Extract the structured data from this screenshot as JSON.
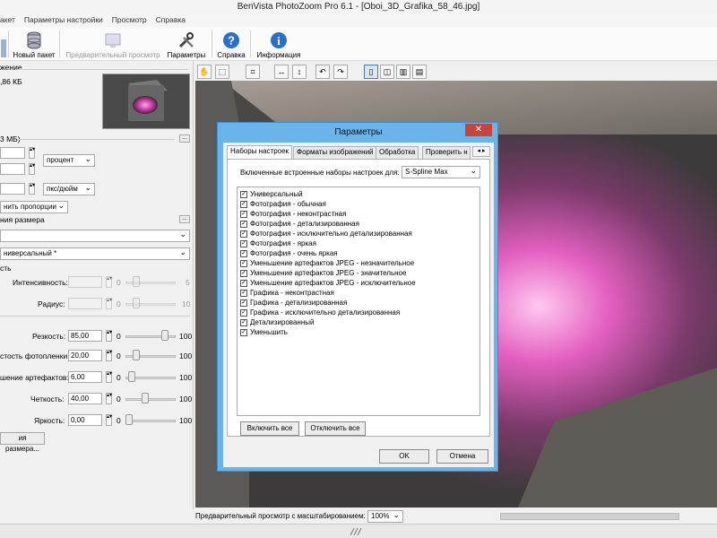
{
  "window": {
    "title": "BenVista PhotoZoom Pro 6.1 - [Oboi_3D_Grafika_58_46.jpg]"
  },
  "menu": [
    "акет",
    "Параметры настройки",
    "Просмотр",
    "Справка"
  ],
  "toolbar": {
    "new_batch": "Новый пакет",
    "preview": "Предварительный просмотр",
    "settings": "Параметры",
    "help": "Справка",
    "info": "Информация"
  },
  "left": {
    "section1": "жение",
    "file_size": ",86 КБ",
    "section2": "3 МБ)",
    "unit_percent": "процент",
    "unit_resolution": "пкс/дюйм",
    "keep_proportions": "нить пропорции",
    "resize_method_label": "ния размера",
    "preset_value": "ниверсальный *",
    "section3": "сть",
    "intensity_label": "Интенсивность:",
    "radius_label": "Радиус:",
    "sharpness_label": "Резкость:",
    "sharpness_value": "85,00",
    "film_grain_label": "стость фотопленки:",
    "film_grain_value": "20,00",
    "artifact_label": "шение артефактов:",
    "artifact_value": "6,00",
    "clarity_label": "Четкость:",
    "clarity_value": "40,00",
    "brightness_label": "Яркость:",
    "brightness_value": "0,00",
    "resize_button": "ия размера...",
    "min0": "0",
    "max5": "5",
    "max10": "10",
    "max100": "100"
  },
  "dialog": {
    "title": "Параметры",
    "close": "✕",
    "tabs": [
      "Наборы настроек",
      "Форматы изображений",
      "Обработка",
      "Проверить н"
    ],
    "included_label": "Включенные встроенные наборы настроек для:",
    "method_value": "S-Spline Max",
    "presets": [
      "Универсальный",
      "Фотография - обычная",
      "Фотография - неконтрастная",
      "Фотография - детализированная",
      "Фотография - исключительно детализированная",
      "Фотография - яркая",
      "Фотография - очень яркая",
      "Уменьшение артефактов JPEG - незначительное",
      "Уменьшение артефактов JPEG - значительное",
      "Уменьшение артефактов JPEG - исключительное",
      "Графика - неконтрастная",
      "Графика - детализированная",
      "Графика - исключительно детализированная",
      "Детализированный",
      "Уменьшить"
    ],
    "enable_all": "Включить все",
    "disable_all": "Отключить все",
    "ok": "OK",
    "cancel": "Отмена"
  },
  "status": {
    "zoom_label": "Предварительный просмотр с масштабированием:",
    "zoom_value": "100%"
  },
  "colors": {
    "dialog_frame": "#6ab4ea",
    "close_button": "#c7453a",
    "accent_help": "#2c6fc9"
  }
}
